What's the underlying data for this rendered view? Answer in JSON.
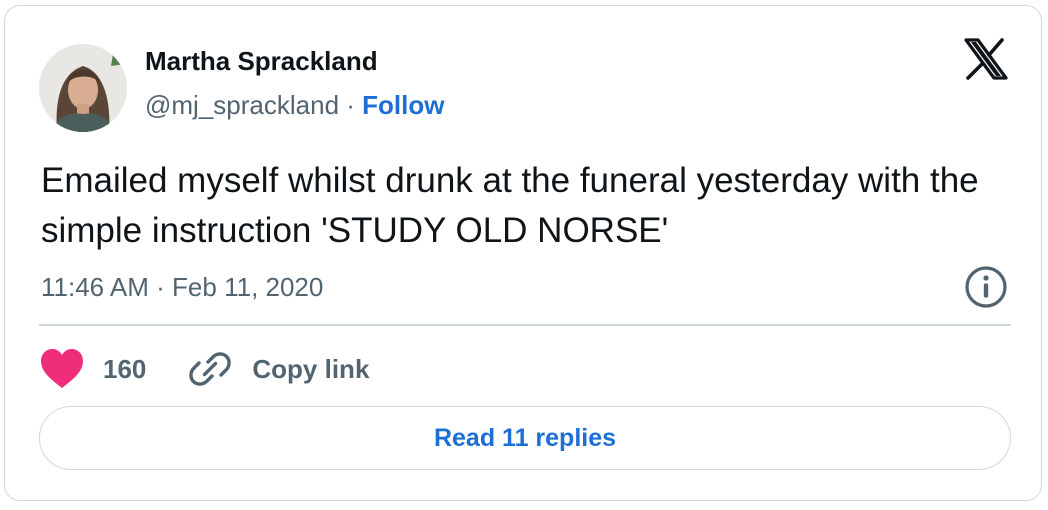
{
  "author": {
    "name": "Martha Sprackland",
    "handle": "@mj_sprackland",
    "separator": " · ",
    "follow_label": "Follow"
  },
  "tweet": {
    "text": "Emailed myself whilst drunk at the funeral yesterday with the simple instruction 'STUDY OLD NORSE'",
    "time": "11:46 AM",
    "meta_separator": " · ",
    "date": "Feb 11, 2020"
  },
  "actions": {
    "like_count": "160",
    "copy_label": "Copy link"
  },
  "replies": {
    "label": "Read 11 replies"
  },
  "icons": {
    "brand": "x-logo-icon",
    "info": "info-icon",
    "like": "heart-icon",
    "copy": "link-icon"
  },
  "colors": {
    "accent": "#1d6fd6",
    "heart": "#f02d7a",
    "muted": "#536471",
    "border": "#cfd9de",
    "text": "#0f1419"
  }
}
